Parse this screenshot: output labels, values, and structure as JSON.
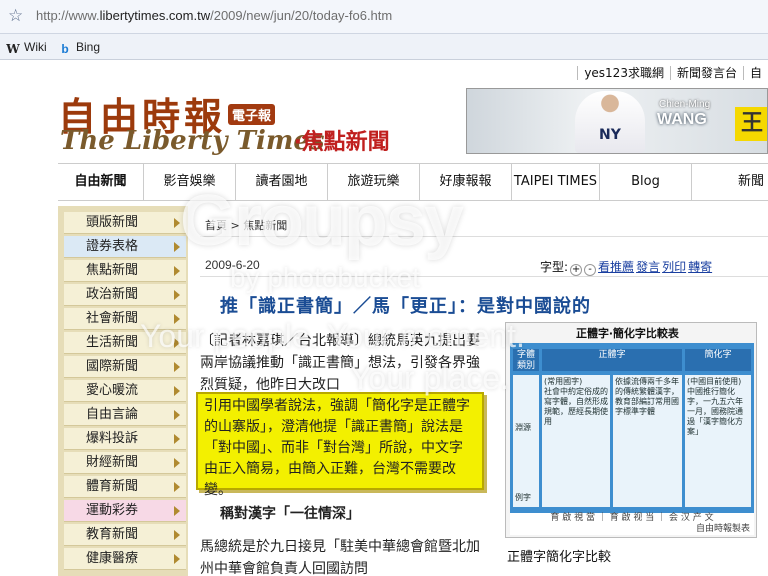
{
  "browser": {
    "url_prefix": "http://www.",
    "url_domain": "libertytimes.com.tw",
    "url_path": "/2009/new/jun/20/today-fo6.htm",
    "bookmarks": [
      {
        "icon": "wikipedia-icon",
        "label": "Wiki"
      },
      {
        "icon": "bing-icon",
        "label": "Bing"
      }
    ]
  },
  "toplinks": [
    "yes123求職網",
    "新聞發言台",
    "自"
  ],
  "masthead": {
    "logo_zh": "自由時報",
    "logo_badge": "電子報",
    "logo_en": "The Liberty Times",
    "section": "‧焦點新聞",
    "banner": {
      "name_line1": "Chien-Ming",
      "name_line2": "WANG",
      "team": "NY",
      "ad_char": "王"
    }
  },
  "nav": [
    "自由新聞",
    "影音娛樂",
    "讀者園地",
    "旅遊玩樂",
    "好康報報",
    "TAIPEI TIMES",
    "Blog",
    "新聞"
  ],
  "sidebar": [
    "頭版新聞",
    "證券表格",
    "焦點新聞",
    "政治新聞",
    "社會新聞",
    "生活新聞",
    "國際新聞",
    "愛心暖流",
    "自由言論",
    "爆料投訴",
    "財經新聞",
    "體育新聞",
    "運動彩券",
    "教育新聞",
    "健康醫療"
  ],
  "article": {
    "breadcrumb_home": "首頁",
    "breadcrumb_sep": " > ",
    "breadcrumb_section": "焦點新聞",
    "date": "2009-6-20",
    "font_label": "字型:",
    "font_plus": "+",
    "font_minus": "-",
    "tools": [
      "看推薦",
      "發言",
      "列印",
      "轉寄"
    ],
    "headline": "推「識正書簡」／馬「更正」：是對中國說的",
    "para1": "〔記者林嘉琪／台北報導〕總統馬英九提出要兩岸協議推動「識正書簡」想法，引發各界強烈質疑，他昨日大改口",
    "callout": "引用中國學者說法，強調「簡化字是正體字的山寨版」，澄清他提「識正書簡」說法是「對中國」、而非「對台灣」所說，中文字由正入簡易，由簡入正難，台灣不需要改變。",
    "subhead": "稱對漢字「一往情深」",
    "para2": "馬總統是於九日接見「駐美中華總會館暨北加州中華會館負責人回國訪問"
  },
  "figure": {
    "title": "正體字‧簡化字比較表",
    "col_headers": [
      "字體類別",
      "正體字",
      "簡化字"
    ],
    "sub_headers": [
      "(常用國字)",
      "(中國目前使用)"
    ],
    "row_label_a": "淵源",
    "row_label_b": "例字",
    "cell_a": "社會中約定俗成的寫字體，自然形成規範，歷經長期使用",
    "cell_b": "依據流傳兩千多年的傳統繁體漢字，教育部編訂常用國字標準字體",
    "cell_c": "中國推行簡化字，一九五六年一月，國務院通過「漢字簡化方案」",
    "examples": "育 啟 視 當 ｜ 育 啟 视 当 ｜ 会 汉 产 文",
    "credit": "自由時報製表",
    "caption": "正體字簡化字比較"
  },
  "watermark": {
    "line1": "Groupsy",
    "line2": "by photobucket",
    "line3": "Your people. Your moment.",
    "line4": "Your place."
  }
}
